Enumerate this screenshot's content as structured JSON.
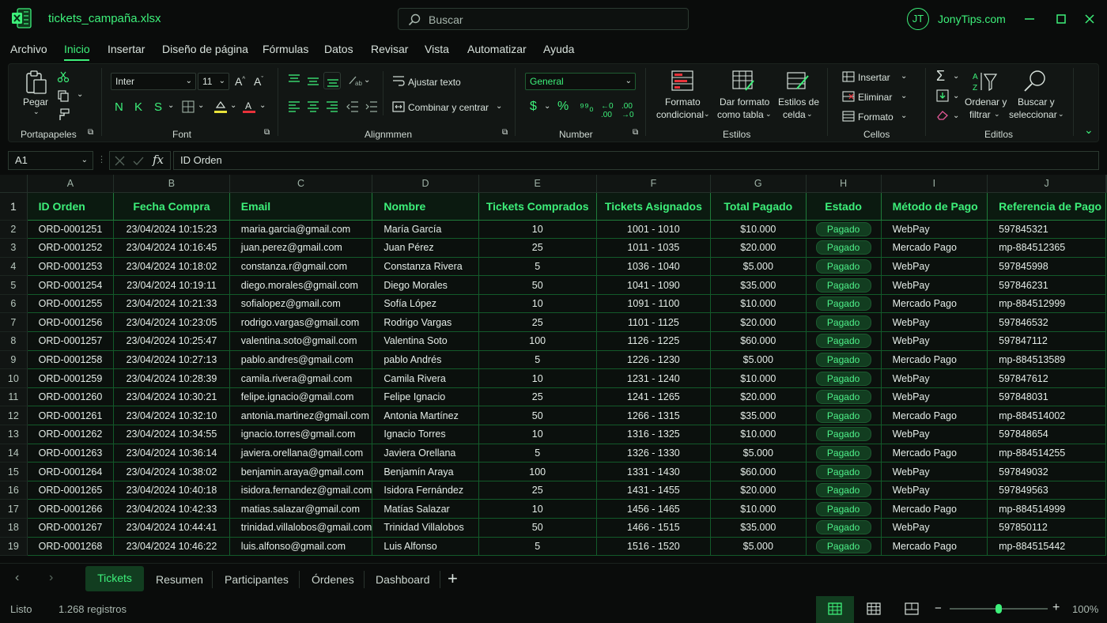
{
  "app": {
    "file_name": "tickets_campaña.xlsx",
    "search_placeholder": "Buscar",
    "user_initials": "JT",
    "user_name": "JonyTips.com"
  },
  "menu": [
    "Archivo",
    "Inicio",
    "Insertar",
    "Diseño de página",
    "Fórmulas",
    "Datos",
    "Revisar",
    "Vista",
    "Automatizar",
    "Ayuda"
  ],
  "ribbon": {
    "clipboard": {
      "paste": "Pegar",
      "label": "Portapapeles"
    },
    "font": {
      "family": "Inter",
      "size": "11",
      "bold": "N",
      "italic": "K",
      "underline": "S",
      "label": "Font"
    },
    "alignment": {
      "wrap": "Ajustar texto",
      "merge": "Combinar y centrar",
      "label": "Alignmmen"
    },
    "number": {
      "format": "General",
      "label": "Number"
    },
    "styles": {
      "conditional_1": "Formato",
      "conditional_2": "condicional",
      "table_1": "Dar formato",
      "table_2": "como tabla",
      "cell_1": "Estilos de",
      "cell_2": "celda",
      "label": "Estilos"
    },
    "cells": {
      "insert": "Insertar",
      "delete": "Eliminar",
      "format": "Formato",
      "label": "Cellos"
    },
    "editing": {
      "sort_1": "Ordenar y",
      "sort_2": "filtrar",
      "find_1": "Buscar y",
      "find_2": "seleccionar",
      "label": "Editlos"
    }
  },
  "formula_bar": {
    "cell": "A1",
    "content": "ID Orden"
  },
  "grid": {
    "columns": [
      "A",
      "B",
      "C",
      "D",
      "E",
      "F",
      "G",
      "H",
      "I",
      "J"
    ],
    "headers": [
      "ID Orden",
      "Fecha Compra",
      "Email",
      "Nombre",
      "Tickets Comprados",
      "Tickets Asignados",
      "Total Pagado",
      "Estado",
      "Método de Pago",
      "Referencia de Pago"
    ],
    "rows": [
      [
        "ORD-0001251",
        "23/04/2024 10:15:23",
        "maria.garcia@gmail.com",
        "María García",
        "10",
        "1001 - 1010",
        "$10.000",
        "Pagado",
        "WebPay",
        "597845321"
      ],
      [
        "ORD-0001252",
        "23/04/2024 10:16:45",
        "juan.perez@gmail.com",
        "Juan Pérez",
        "25",
        "1011 - 1035",
        "$20.000",
        "Pagado",
        "Mercado Pago",
        "mp-884512365"
      ],
      [
        "ORD-0001253",
        "23/04/2024 10:18:02",
        "constanza.r@gmail.com",
        "Constanza Rivera",
        "5",
        "1036 - 1040",
        "$5.000",
        "Pagado",
        "WebPay",
        "597845998"
      ],
      [
        "ORD-0001254",
        "23/04/2024 10:19:11",
        "diego.morales@gmail.com",
        "Diego Morales",
        "50",
        "1041 - 1090",
        "$35.000",
        "Pagado",
        "WebPay",
        "597846231"
      ],
      [
        "ORD-0001255",
        "23/04/2024 10:21:33",
        "sofialopez@gmail.com",
        "Sofía López",
        "10",
        "1091 - 1100",
        "$10.000",
        "Pagado",
        "Mercado Pago",
        "mp-884512999"
      ],
      [
        "ORD-0001256",
        "23/04/2024 10:23:05",
        "rodrigo.vargas@gmail.com",
        "Rodrigo Vargas",
        "25",
        "1101 - 1125",
        "$20.000",
        "Pagado",
        "WebPay",
        "597846532"
      ],
      [
        "ORD-0001257",
        "23/04/2024 10:25:47",
        "valentina.soto@gmail.com",
        "Valentina Soto",
        "100",
        "1126 - 1225",
        "$60.000",
        "Pagado",
        "WebPay",
        "597847112"
      ],
      [
        "ORD-0001258",
        "23/04/2024 10:27:13",
        "pablo.andres@gmail.com",
        "pablo Andrés",
        "5",
        "1226 - 1230",
        "$5.000",
        "Pagado",
        "Mercado Pago",
        "mp-884513589"
      ],
      [
        "ORD-0001259",
        "23/04/2024 10:28:39",
        "camila.rivera@gmail.com",
        "Camila Rivera",
        "10",
        "1231 - 1240",
        "$10.000",
        "Pagado",
        "WebPay",
        "597847612"
      ],
      [
        "ORD-0001260",
        "23/04/2024 10:30:21",
        "felipe.ignacio@gmail.com",
        "Felipe Ignacio",
        "25",
        "1241 - 1265",
        "$20.000",
        "Pagado",
        "WebPay",
        "597848031"
      ],
      [
        "ORD-0001261",
        "23/04/2024 10:32:10",
        "antonia.martinez@gmail.com",
        "Antonia Martínez",
        "50",
        "1266 - 1315",
        "$35.000",
        "Pagado",
        "Mercado Pago",
        "mp-884514002"
      ],
      [
        "ORD-0001262",
        "23/04/2024 10:34:55",
        "ignacio.torres@gmail.com",
        "Ignacio Torres",
        "10",
        "1316 - 1325",
        "$10.000",
        "Pagado",
        "WebPay",
        "597848654"
      ],
      [
        "ORD-0001263",
        "23/04/2024 10:36:14",
        "javiera.orellana@gmail.com",
        "Javiera Orellana",
        "5",
        "1326 - 1330",
        "$5.000",
        "Pagado",
        "Mercado Pago",
        "mp-884514255"
      ],
      [
        "ORD-0001264",
        "23/04/2024 10:38:02",
        "benjamin.araya@gmail.com",
        "Benjamín Araya",
        "100",
        "1331 - 1430",
        "$60.000",
        "Pagado",
        "WebPay",
        "597849032"
      ],
      [
        "ORD-0001265",
        "23/04/2024 10:40:18",
        "isidora.fernandez@gmail.com",
        "Isidora Fernández",
        "25",
        "1431 - 1455",
        "$20.000",
        "Pagado",
        "WebPay",
        "597849563"
      ],
      [
        "ORD-0001266",
        "23/04/2024 10:42:33",
        "matias.salazar@gmail.com",
        "Matías Salazar",
        "10",
        "1456 - 1465",
        "$10.000",
        "Pagado",
        "Mercado Pago",
        "mp-884514999"
      ],
      [
        "ORD-0001267",
        "23/04/2024 10:44:41",
        "trinidad.villalobos@gmail.com",
        "Trinidad Villalobos",
        "50",
        "1466 - 1515",
        "$35.000",
        "Pagado",
        "WebPay",
        "597850112"
      ],
      [
        "ORD-0001268",
        "23/04/2024 10:46:22",
        "luis.alfonso@gmail.com",
        "Luis Alfonso",
        "5",
        "1516 - 1520",
        "$5.000",
        "Pagado",
        "Mercado Pago",
        "mp-884515442"
      ]
    ]
  },
  "sheets": {
    "tabs": [
      "Tickets",
      "Resumen",
      "Participantes",
      "Órdenes",
      "Dashboard"
    ],
    "active": "Tickets"
  },
  "status": {
    "ready": "Listo",
    "records": "1.268 registros",
    "zoom": "100%"
  },
  "colors": {
    "accent": "#3df07a",
    "background": "#0a0c0b",
    "badge_bg": "#123d20"
  }
}
